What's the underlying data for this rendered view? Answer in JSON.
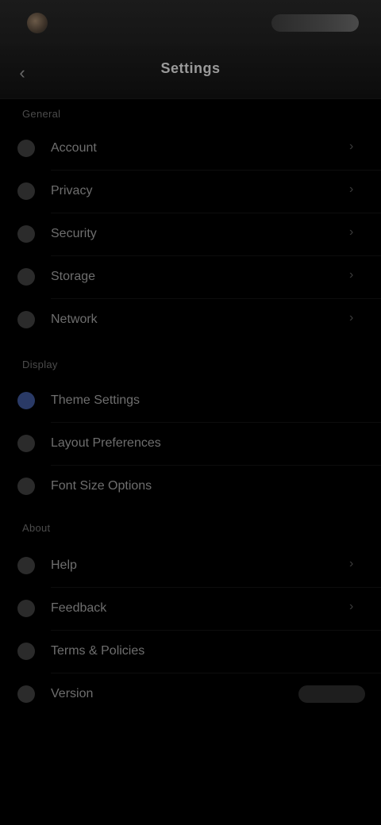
{
  "header": {
    "title": "Settings",
    "back_icon": "chevron-left-icon"
  },
  "sections": [
    {
      "title": "General",
      "items": [
        {
          "label": "Account",
          "icon": "user-icon",
          "value": "›"
        },
        {
          "label": "Privacy",
          "icon": "lock-icon",
          "value": "›"
        },
        {
          "label": "Security",
          "icon": "shield-icon",
          "value": "›"
        },
        {
          "label": "Storage",
          "icon": "disk-icon",
          "value": "›"
        },
        {
          "label": "Network",
          "icon": "wifi-icon",
          "value": "›"
        }
      ]
    },
    {
      "title": "Display",
      "items": [
        {
          "label": "Theme Settings",
          "icon": "palette-icon",
          "value": ""
        },
        {
          "label": "Layout Preferences",
          "icon": "grid-icon",
          "value": ""
        },
        {
          "label": "Font Size Options",
          "icon": "text-size-icon",
          "value": ""
        }
      ]
    },
    {
      "title": "About",
      "items": [
        {
          "label": "Help",
          "icon": "help-icon",
          "value": "›"
        },
        {
          "label": "Feedback",
          "icon": "feedback-icon",
          "value": "›"
        },
        {
          "label": "Terms & Policies",
          "icon": "document-icon",
          "value": ""
        },
        {
          "label": "Version",
          "icon": "info-icon",
          "value": ""
        }
      ]
    }
  ]
}
